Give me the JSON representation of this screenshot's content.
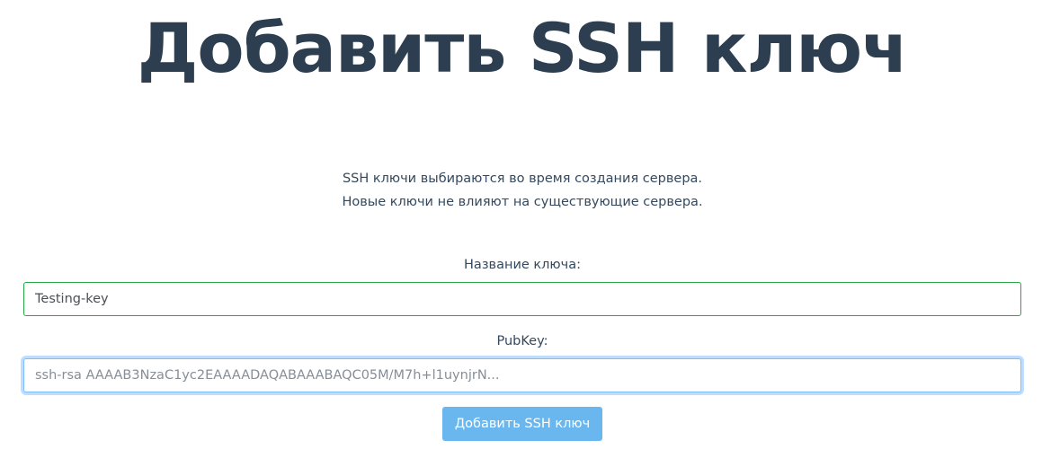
{
  "page": {
    "title": "Добавить SSH ключ",
    "intro_line1": "SSH ключи выбираются во время создания сервера.",
    "intro_line2": "Новые ключи не влияют на существующие сервера."
  },
  "form": {
    "name_label": "Название ключа:",
    "name_value": "Testing-key",
    "pubkey_label": "PubKey:",
    "pubkey_placeholder": "ssh-rsa AAAAB3NzaC1yc2EAAAADAQABAAABAQC05M/M7h+l1uynjrN...",
    "pubkey_value": "",
    "submit_label": "Добавить SSH ключ"
  },
  "colors": {
    "title": "#2c3e50",
    "valid_border": "#28a745",
    "focus_border": "#80bdff",
    "button_bg": "#6ab7ef"
  }
}
